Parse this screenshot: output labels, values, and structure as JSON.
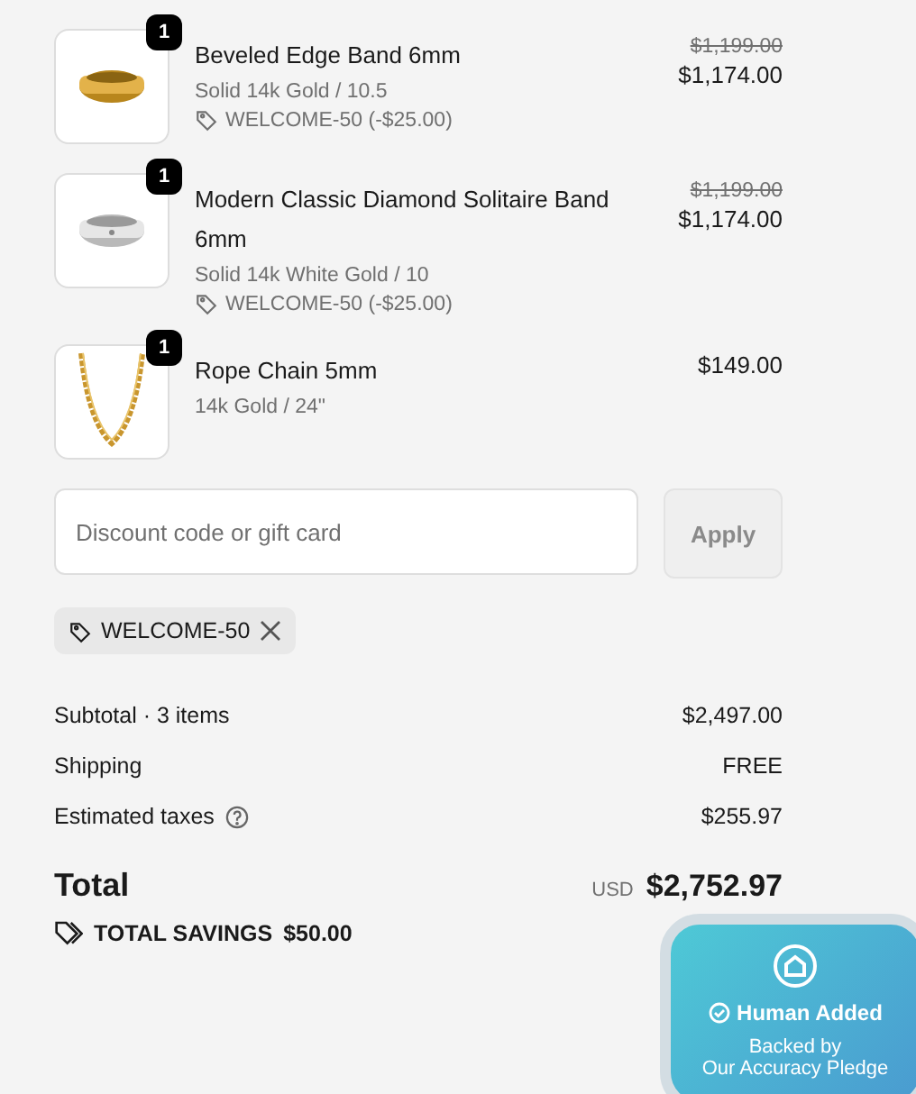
{
  "items": [
    {
      "quantity": "1",
      "title": "Beveled Edge Band 6mm",
      "variant": "Solid 14k Gold / 10.5",
      "discount": "WELCOME-50 (-$25.00)",
      "original_price": "$1,199.00",
      "price": "$1,174.00",
      "kind": "gold-band"
    },
    {
      "quantity": "1",
      "title": "Modern Classic Diamond Solitaire Band 6mm",
      "variant": "Solid 14k White Gold / 10",
      "discount": "WELCOME-50 (-$25.00)",
      "original_price": "$1,199.00",
      "price": "$1,174.00",
      "kind": "silver-band"
    },
    {
      "quantity": "1",
      "title": "Rope Chain 5mm",
      "variant": "14k Gold / 24\"",
      "price": "$149.00",
      "kind": "chain"
    }
  ],
  "discount_field": {
    "placeholder": "Discount code or gift card",
    "button": "Apply"
  },
  "applied_code": "WELCOME-50",
  "summary": [
    {
      "label": "Subtotal · 3 items",
      "value": "$2,497.00",
      "help": false
    },
    {
      "label": "Shipping",
      "value": "FREE",
      "help": false
    },
    {
      "label": "Estimated taxes",
      "value": "$255.97",
      "help": true
    }
  ],
  "total": {
    "label": "Total",
    "currency": "USD",
    "value": "$2,752.97"
  },
  "savings": {
    "label": "TOTAL SAVINGS",
    "value": "$50.00"
  },
  "pledge_badge": {
    "title": "Human Added",
    "line_1": "Backed by",
    "line_2": "Our Accuracy Pledge"
  }
}
